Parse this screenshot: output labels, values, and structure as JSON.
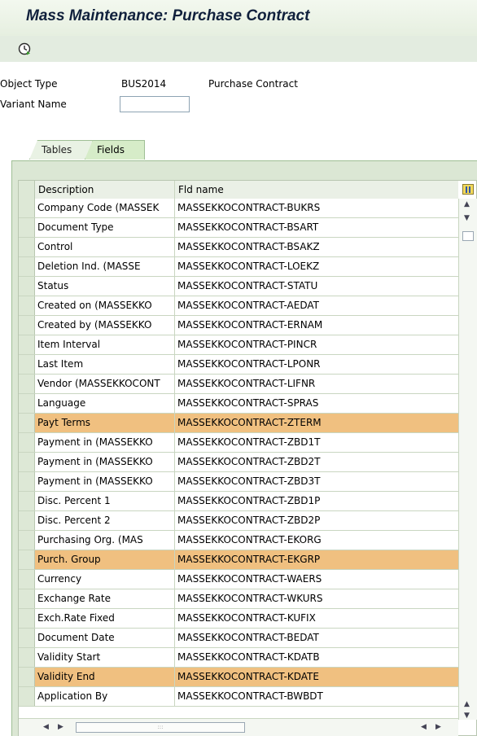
{
  "window": {
    "title": "Mass Maintenance: Purchase Contract"
  },
  "toolbar": {
    "execute_icon": "execute-clock-icon"
  },
  "header_fields": {
    "object_type_label": "Object Type",
    "object_type_value": "BUS2014",
    "object_type_text": "Purchase Contract",
    "variant_name_label": "Variant Name",
    "variant_name_value": ""
  },
  "tabs": [
    {
      "label": "Tables",
      "active": false
    },
    {
      "label": "Fields",
      "active": true
    }
  ],
  "table": {
    "columns": [
      "Description",
      "Fld name"
    ],
    "selected_color": "#f0c080",
    "rows": [
      {
        "desc": "Company Code (MASSEK",
        "fld": "MASSEKKOCONTRACT-BUKRS",
        "selected": false
      },
      {
        "desc": "Document Type",
        "fld": "MASSEKKOCONTRACT-BSART",
        "selected": false
      },
      {
        "desc": "Control",
        "fld": "MASSEKKOCONTRACT-BSAKZ",
        "selected": false
      },
      {
        "desc": "Deletion Ind. (MASSE",
        "fld": "MASSEKKOCONTRACT-LOEKZ",
        "selected": false
      },
      {
        "desc": "Status",
        "fld": "MASSEKKOCONTRACT-STATU",
        "selected": false
      },
      {
        "desc": "Created on (MASSEKKO",
        "fld": "MASSEKKOCONTRACT-AEDAT",
        "selected": false
      },
      {
        "desc": "Created by (MASSEKKO",
        "fld": "MASSEKKOCONTRACT-ERNAM",
        "selected": false
      },
      {
        "desc": "Item Interval",
        "fld": "MASSEKKOCONTRACT-PINCR",
        "selected": false
      },
      {
        "desc": "Last Item",
        "fld": "MASSEKKOCONTRACT-LPONR",
        "selected": false
      },
      {
        "desc": "Vendor (MASSEKKOCONT",
        "fld": "MASSEKKOCONTRACT-LIFNR",
        "selected": false
      },
      {
        "desc": "Language",
        "fld": "MASSEKKOCONTRACT-SPRAS",
        "selected": false
      },
      {
        "desc": "Payt Terms",
        "fld": "MASSEKKOCONTRACT-ZTERM",
        "selected": true
      },
      {
        "desc": "Payment in (MASSEKKO",
        "fld": "MASSEKKOCONTRACT-ZBD1T",
        "selected": false
      },
      {
        "desc": "Payment in (MASSEKKO",
        "fld": "MASSEKKOCONTRACT-ZBD2T",
        "selected": false
      },
      {
        "desc": "Payment in (MASSEKKO",
        "fld": "MASSEKKOCONTRACT-ZBD3T",
        "selected": false
      },
      {
        "desc": "Disc. Percent 1",
        "fld": "MASSEKKOCONTRACT-ZBD1P",
        "selected": false
      },
      {
        "desc": "Disc. Percent 2",
        "fld": "MASSEKKOCONTRACT-ZBD2P",
        "selected": false
      },
      {
        "desc": "Purchasing Org. (MAS",
        "fld": "MASSEKKOCONTRACT-EKORG",
        "selected": false
      },
      {
        "desc": "Purch. Group",
        "fld": "MASSEKKOCONTRACT-EKGRP",
        "selected": true
      },
      {
        "desc": "Currency",
        "fld": "MASSEKKOCONTRACT-WAERS",
        "selected": false
      },
      {
        "desc": "Exchange Rate",
        "fld": "MASSEKKOCONTRACT-WKURS",
        "selected": false
      },
      {
        "desc": "Exch.Rate Fixed",
        "fld": "MASSEKKOCONTRACT-KUFIX",
        "selected": false
      },
      {
        "desc": "Document Date",
        "fld": "MASSEKKOCONTRACT-BEDAT",
        "selected": false
      },
      {
        "desc": "Validity Start",
        "fld": "MASSEKKOCONTRACT-KDATB",
        "selected": false
      },
      {
        "desc": "Validity End",
        "fld": "MASSEKKOCONTRACT-KDATE",
        "selected": true
      },
      {
        "desc": "Application By",
        "fld": "MASSEKKOCONTRACT-BWBDT",
        "selected": false
      }
    ]
  }
}
